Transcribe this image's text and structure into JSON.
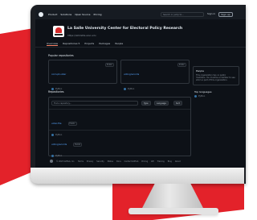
{
  "colors": {
    "background_red": "#e3222a",
    "link_blue": "#58a6ff",
    "python_dot": "#3572A5",
    "accent_tab": "#f78166"
  },
  "topbar": {
    "nav": [
      "Product",
      "Solutions",
      "Open Source",
      "Pricing"
    ],
    "search_placeholder": "Search or jump to...",
    "sign_in": "Sign in",
    "sign_up": "Sign up"
  },
  "org": {
    "name": "La Follette Sch Univ. Wisconsin-Madison ",
    "name_display": "La Follette School of Public Affairs",
    "display": "La Salle University Center for Electoral Policy Research",
    "link": "https://lafollette.wisc.edu"
  },
  "tabs": [
    "Overview",
    "Repositories 5",
    "Projects",
    "Packages",
    "People"
  ],
  "pinned": {
    "title": "Popular repositories",
    "cards": [
      {
        "name": "corrupt-voter",
        "badge": "Public",
        "desc": "",
        "lang": "Python",
        "stars": ""
      },
      {
        "name": "votingrecords",
        "badge": "Public",
        "desc": "",
        "lang": "Python",
        "stars": ""
      }
    ]
  },
  "sidebar": {
    "people_title": "People",
    "people_text": "This organization has no public members. You must be a member to see who's a part of this organization.",
    "lang_title": "Top languages",
    "lang_item": "Python"
  },
  "repos": {
    "title": "Repositories",
    "find_placeholder": "Find a repository...",
    "type_label": "Type",
    "language_label": "Language",
    "sort_label": "Sort",
    "items": [
      {
        "name": "voter-file",
        "badge": "Public",
        "desc": "",
        "lang": "Python",
        "meta": ""
      },
      {
        "name": "votingrecords",
        "badge": "Public",
        "desc": "",
        "lang": "Python",
        "meta": ""
      }
    ]
  },
  "footer": {
    "copyright": "© 2023 GitHub, Inc.",
    "links": [
      "Terms",
      "Privacy",
      "Security",
      "Status",
      "Docs",
      "Contact GitHub",
      "Pricing",
      "API",
      "Training",
      "Blog",
      "About"
    ]
  }
}
